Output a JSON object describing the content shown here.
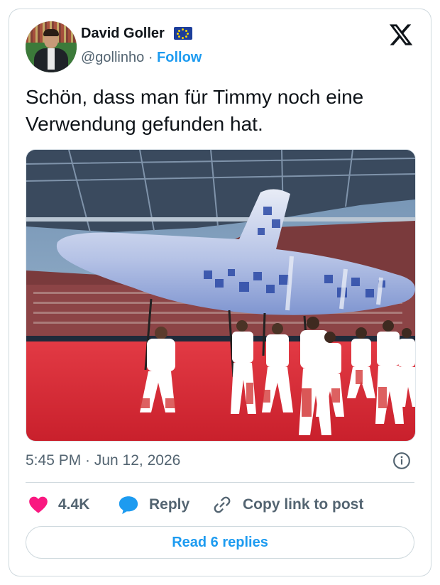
{
  "author": {
    "name": "David Goller",
    "handle": "@gollinho",
    "separator": "·",
    "follow_label": "Follow",
    "badge": "eu-flag-icon"
  },
  "tweet": {
    "text": "Schön, dass man für Timmy noch eine Verwendung gefunden hat.",
    "media": "photo of a stadium opening ceremony with performers in white carrying a large inflatable blue-mosaic whale on poles over a red carpet",
    "timestamp": "5:45 PM · Jun 12, 2026"
  },
  "actions": {
    "like_count": "4.4K",
    "reply_label": "Reply",
    "copy_link_label": "Copy link to post"
  },
  "footer": {
    "read_replies_label": "Read 6 replies"
  },
  "colors": {
    "accent": "#1d9bf0",
    "like": "#f91880",
    "muted": "#536471",
    "border": "#cfd9de"
  }
}
